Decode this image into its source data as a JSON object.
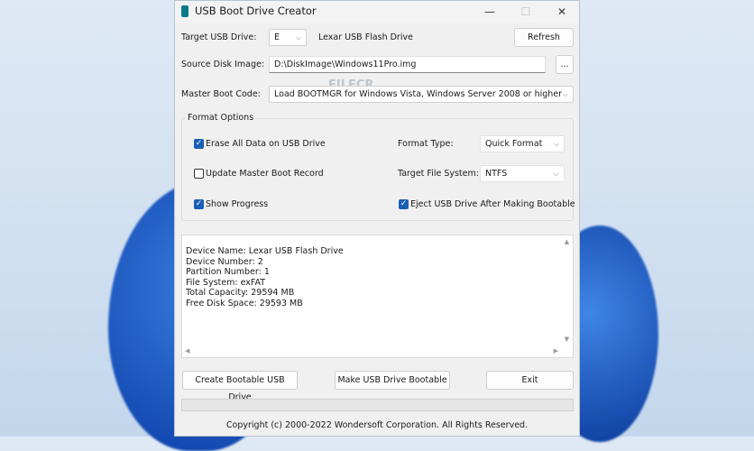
{
  "window": {
    "title": "USB Boot Drive Creator",
    "minimize": "—",
    "maximize": "☐",
    "close": "✕"
  },
  "target": {
    "label": "Target USB Drive:",
    "drive": "E",
    "drive_name": "Lexar USB Flash Drive",
    "refresh": "Refresh"
  },
  "source": {
    "label": "Source Disk Image:",
    "value": "D:\\DiskImage\\Windows11Pro.img",
    "browse": "..."
  },
  "mbc": {
    "label": "Master Boot Code:",
    "value": "Load BOOTMGR for Windows Vista, Windows Server 2008 or higher"
  },
  "format": {
    "title": "Format Options",
    "erase": {
      "label": "Erase All Data on USB Drive",
      "checked": true
    },
    "update_mbr": {
      "label": "Update Master Boot Record",
      "checked": false
    },
    "show_progress": {
      "label": "Show Progress",
      "checked": true
    },
    "eject": {
      "label": "Eject USB Drive After Making Bootable",
      "checked": true
    },
    "format_type_label": "Format Type:",
    "format_type": "Quick Format",
    "fs_label": "Target File System:",
    "fs": "NTFS"
  },
  "info": [
    "Device Name: Lexar USB Flash Drive",
    "Device Number: 2",
    "Partition Number: 1",
    "File System: exFAT",
    "Total Capacity: 29594 MB",
    "Free Disk Space: 29593 MB"
  ],
  "buttons": {
    "create": "Create Bootable USB Drive",
    "make": "Make USB Drive Bootable",
    "exit": "Exit"
  },
  "progress": 0,
  "copyright": "Copyright (c) 2000-2022 Wondersoft Corporation. All Rights Reserved.",
  "watermark": "FILECR"
}
